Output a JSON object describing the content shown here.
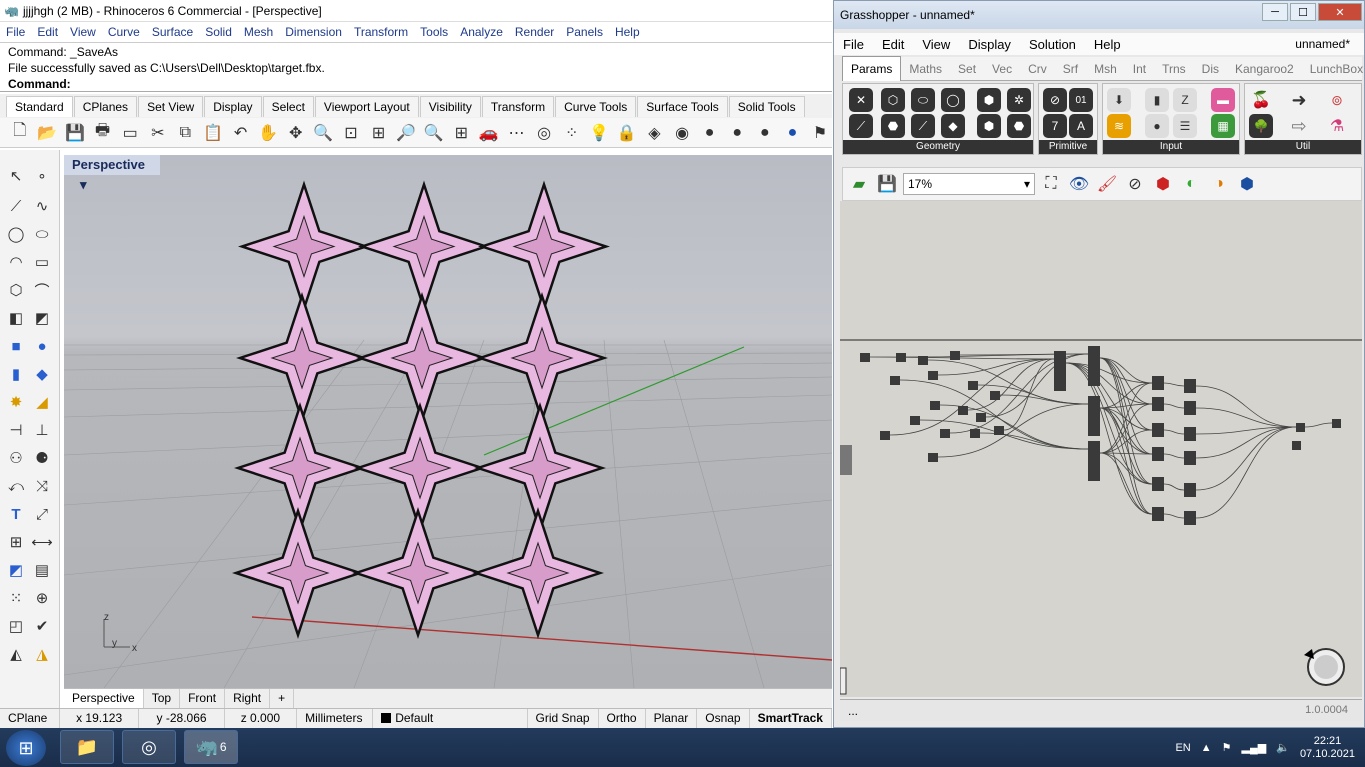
{
  "rhino": {
    "title": "jjjjhgh (2 MB) - Rhinoceros 6 Commercial - [Perspective]",
    "menu": [
      "File",
      "Edit",
      "View",
      "Curve",
      "Surface",
      "Solid",
      "Mesh",
      "Dimension",
      "Transform",
      "Tools",
      "Analyze",
      "Render",
      "Panels",
      "Help"
    ],
    "command_history": [
      "Command: _SaveAs",
      "File successfully saved as C:\\Users\\Dell\\Desktop\\target.fbx."
    ],
    "command_prompt": "Command:",
    "toolbar_tabs": [
      "Standard",
      "CPlanes",
      "Set View",
      "Display",
      "Select",
      "Viewport Layout",
      "Visibility",
      "Transform",
      "Curve Tools",
      "Surface Tools",
      "Solid Tools"
    ],
    "viewport_title": "Perspective",
    "viewport_tabs": [
      "Perspective",
      "Top",
      "Front",
      "Right",
      "+"
    ],
    "axis_labels": {
      "z": "z",
      "y": "y",
      "x": "x"
    },
    "status": {
      "cplane": "CPlane",
      "x": "x 19.123",
      "y": "y -28.066",
      "z": "z 0.000",
      "units": "Millimeters",
      "layer": "Default",
      "grid_snap": "Grid Snap",
      "ortho": "Ortho",
      "planar": "Planar",
      "osnap": "Osnap",
      "smarttrack": "SmartTrack"
    }
  },
  "grasshopper": {
    "title": "Grasshopper - unnamed*",
    "menu": [
      "File",
      "Edit",
      "View",
      "Display",
      "Solution",
      "Help"
    ],
    "document": "unnamed*",
    "tabs": [
      "Params",
      "Maths",
      "Set",
      "Vec",
      "Crv",
      "Srf",
      "Msh",
      "Int",
      "Trns",
      "Dis",
      "Kangaroo2",
      "LunchBox"
    ],
    "groups": [
      "Geometry",
      "Primitive",
      "Input",
      "Util"
    ],
    "zoom": "17%",
    "status_left": "...",
    "version": "1.0.0004"
  },
  "taskbar": {
    "language": "EN",
    "time": "22:21",
    "date": "07.10.2021",
    "rhino_badge": "6"
  },
  "colors": {
    "viewport_bg": "#b9bcc4",
    "panel_pink": "#e8b8e0",
    "gh_canvas": "#d5d4ce",
    "x_axis": "#b03030",
    "y_axis": "#2f9a2f"
  }
}
